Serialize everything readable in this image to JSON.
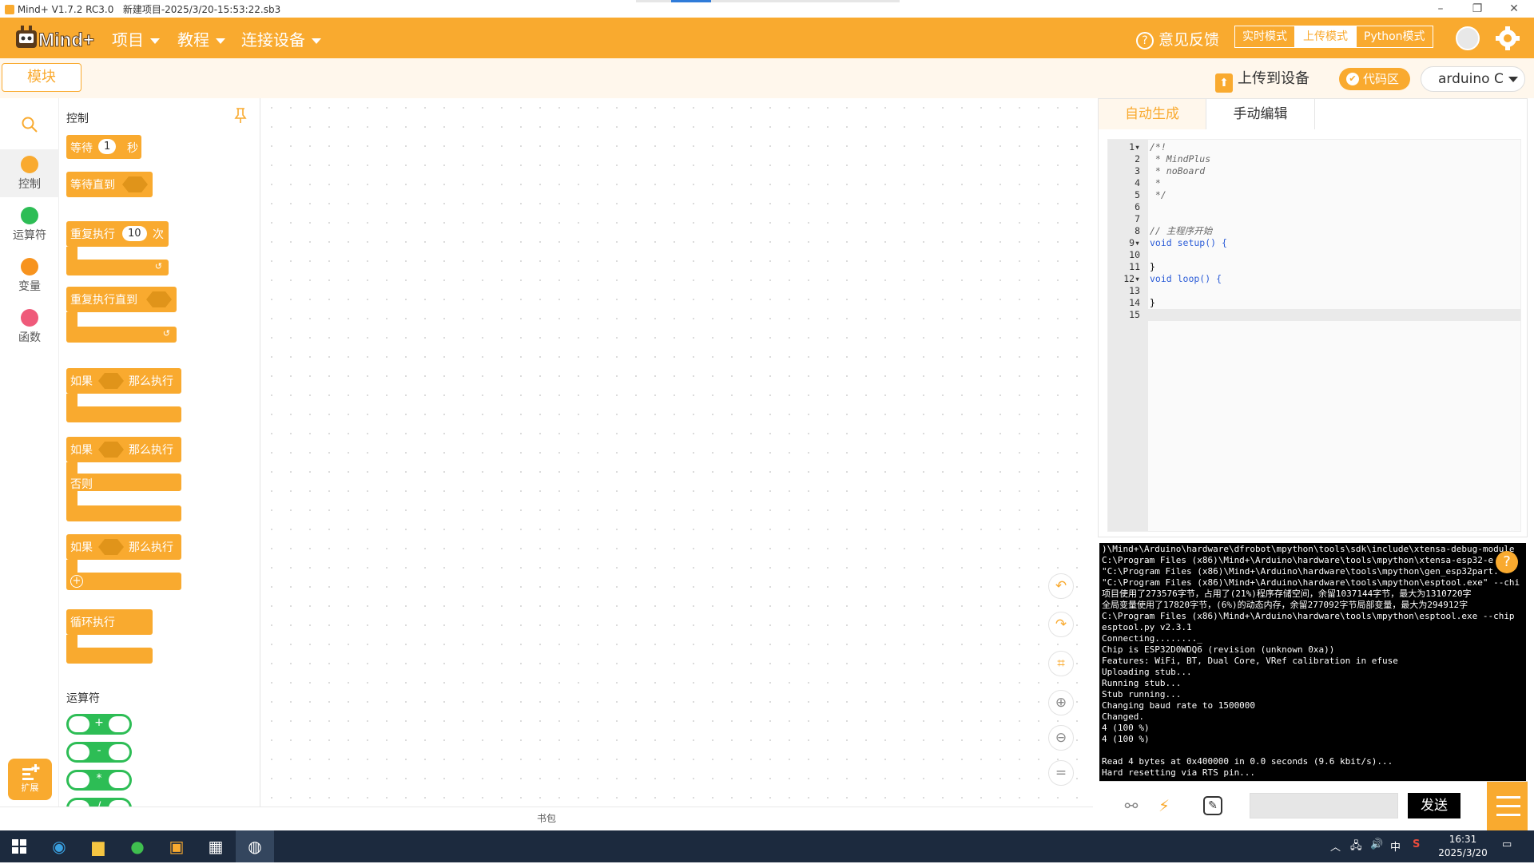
{
  "titlebar": {
    "app": "Mind+ V1.7.2 RC3.0",
    "project": "新建项目-2025/3/20-15:53:22.sb3"
  },
  "menubar": {
    "logo": "Mind+",
    "menus": [
      "项目",
      "教程",
      "连接设备"
    ],
    "feedback": "意见反馈",
    "modes": [
      "实时模式",
      "上传模式",
      "Python模式"
    ],
    "active_mode": "上传模式"
  },
  "toolbar": {
    "blocks_tab": "模块",
    "upload": "上传到设备",
    "code_area": "代码区",
    "board": "arduino C"
  },
  "categories": [
    {
      "label": "控制",
      "color": "#f9aa2f"
    },
    {
      "label": "运算符",
      "color": "#2dbd55"
    },
    {
      "label": "变量",
      "color": "#f7931e"
    },
    {
      "label": "函数",
      "color": "#ef5a7a"
    }
  ],
  "extension_label": "扩展",
  "palette": {
    "control_title": "控制",
    "wait": "等待",
    "wait_value": "1",
    "wait_unit": "秒",
    "wait_until": "等待直到",
    "repeat": "重复执行",
    "repeat_value": "10",
    "repeat_unit": "次",
    "repeat_until": "重复执行直到",
    "if": "如果",
    "then": "那么执行",
    "else": "否则",
    "forever": "循环执行",
    "operators_title": "运算符",
    "ops": [
      "+",
      "-",
      "*",
      "/"
    ]
  },
  "bag_label": "书包",
  "code": {
    "tabs": [
      "自动生成",
      "手动编辑"
    ],
    "lines": [
      "/*!",
      " * MindPlus",
      " * noBoard",
      " *",
      " */",
      "",
      "",
      "// 主程序开始",
      "void setup() {",
      "",
      "}",
      "void loop() {",
      "",
      "}",
      ""
    ]
  },
  "console_lines": [
    ")\\Mind+\\Arduino\\hardware\\dfrobot\\mpython\\tools\\sdk\\include\\xtensa-debug-module",
    "C:\\Program Files (x86)\\Mind+\\Arduino\\hardware\\tools\\mpython\\xtensa-esp32-e",
    "\"C:\\Program Files (x86)\\Mind+\\Arduino\\hardware\\tools\\mpython\\gen_esp32part.",
    "\"C:\\Program Files (x86)\\Mind+\\Arduino\\hardware\\tools\\mpython\\esptool.exe\" --chi",
    "项目使用了273576字节，占用了(21%)程序存储空间，余留1037144字节，最大为1310720字",
    "全局变量使用了17820字节，(6%)的动态内存，余留277092字节局部变量，最大为294912字",
    "C:\\Program Files (x86)\\Mind+\\Arduino\\hardware\\tools\\mpython\\esptool.exe --chip",
    "esptool.py v2.3.1",
    "Connecting........_",
    "Chip is ESP32D0WDQ6 (revision (unknown 0xa))",
    "Features: WiFi, BT, Dual Core, VRef calibration in efuse",
    "Uploading stub...",
    "Running stub...",
    "Stub running...",
    "Changing baud rate to 1500000",
    "Changed.",
    "4 (100 %)",
    "4 (100 %)",
    "",
    "Read 4 bytes at 0x400000 in 0.0 seconds (9.6 kbit/s)...",
    "Hard resetting via RTS pin..."
  ],
  "serial": {
    "send": "发送"
  },
  "taskbar": {
    "ime": "中",
    "time": "16:31",
    "date": "2025/3/20"
  }
}
